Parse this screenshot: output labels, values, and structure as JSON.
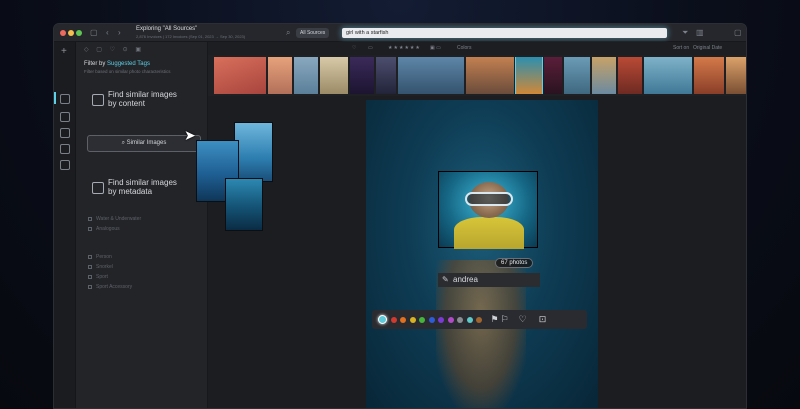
{
  "window": {
    "title": "Exploring \"All Sources\"",
    "subtitle": "2,876 Invoices | 172 Invoices (Sep 01, 2023 → Sep 30, 2023)"
  },
  "toolbar": {
    "source_label": "All Sources",
    "search_value": "girl with a starfish"
  },
  "secondary_toolbar": {
    "colors_label": "Colors",
    "sort_label": "Sort on",
    "sort_value": "Original Date"
  },
  "sidebar": {
    "filter_title_prefix": "Filter by ",
    "filter_title_highlight": "Suggested Tags",
    "filter_subtitle": "Filter based on similar photo characteristics",
    "option_content_line1": "Find similar images",
    "option_content_line2": "by content",
    "similar_button": "Similar Images",
    "option_metadata_line1": "Find similar images",
    "option_metadata_line2": "by metadata",
    "tags_group1": [
      "Water & Underwater",
      "Analogous"
    ],
    "tags_group2": [
      "Person",
      "Snorkel",
      "Sport",
      "Sport Accessory"
    ]
  },
  "viewer": {
    "photos_badge": "67 photos",
    "person_name": "andrea"
  },
  "colors": {
    "accent": "#5ecfe6",
    "swatches": [
      "#ffffff",
      "#d23a2f",
      "#e2701f",
      "#d9b222",
      "#44b53a",
      "#2e5bd8",
      "#7b3ad6",
      "#b04ac9",
      "#8a8d94",
      "#5ec9c9",
      "#a0662e"
    ]
  },
  "icons": {
    "search": "search-icon",
    "filter": "filter-icon",
    "chart": "chart-icon",
    "flag": "flag-icon",
    "heart": "heart-icon",
    "face_scan": "face-scan-icon",
    "edit": "pencil-icon",
    "cursor": "pointer-cursor-icon"
  }
}
